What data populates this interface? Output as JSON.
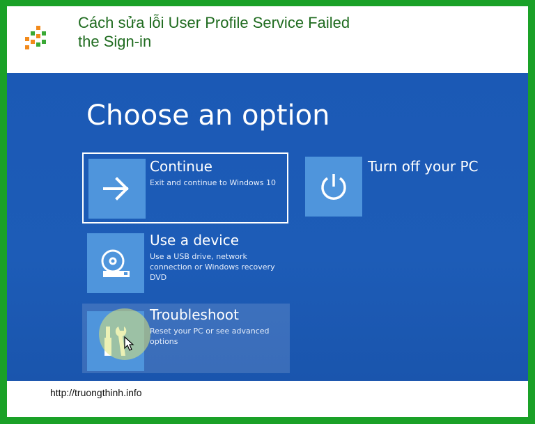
{
  "article": {
    "title_line1": "Cách sửa lỗi User Profile Service Failed",
    "title_line2": "the Sign-in",
    "source_url": "http://truongthinh.info"
  },
  "screen": {
    "heading": "Choose an option",
    "options": [
      {
        "label": "Continue",
        "description": "Exit and continue to Windows 10",
        "icon": "arrow-right-icon",
        "selected": true
      },
      {
        "label": "Use a device",
        "description": "Use a USB drive, network connection or Windows recovery DVD",
        "icon": "disc-icon",
        "selected": false
      },
      {
        "label": "Troubleshoot",
        "description": "Reset your PC or see advanced options",
        "icon": "tools-icon",
        "selected": false,
        "hovered": true
      },
      {
        "label": "Turn off your PC",
        "description": "",
        "icon": "power-icon",
        "selected": false
      }
    ]
  },
  "colors": {
    "frame": "#1aa127",
    "screen_bg": "#1b59b5",
    "tile": "#4f95dc",
    "title_text": "#1f6b1f"
  }
}
